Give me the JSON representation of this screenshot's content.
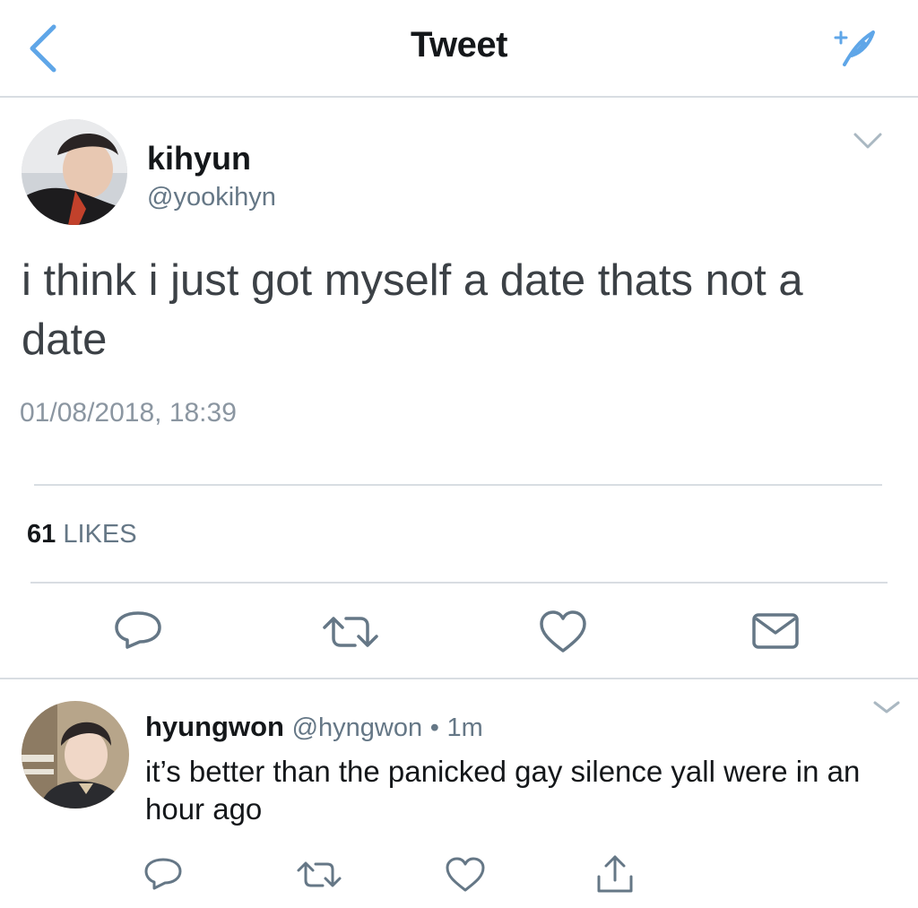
{
  "header": {
    "title": "Tweet",
    "back_icon": "chevron-left-icon",
    "compose_icon": "compose-tweet-icon",
    "accent_color": "#5fa6e8"
  },
  "tweet": {
    "display_name": "kihyun",
    "handle": "@yookihyn",
    "text": "i think i just got myself a date thats not a date",
    "timestamp": "01/08/2018, 18:39",
    "likes_count": "61",
    "likes_label": "LIKES",
    "actions": [
      "reply-icon",
      "retweet-icon",
      "like-icon",
      "direct-message-icon"
    ]
  },
  "reply": {
    "display_name": "hyungwon",
    "handle": "@hyngwon",
    "separator": "•",
    "time": "1m",
    "text": "it’s better than the panicked gay silence yall were in an hour ago",
    "actions": [
      "reply-icon",
      "retweet-icon",
      "like-icon",
      "share-icon"
    ]
  },
  "colors": {
    "icon_gray": "#657786",
    "divider": "#d8dde2",
    "text_dark": "#14171a"
  }
}
